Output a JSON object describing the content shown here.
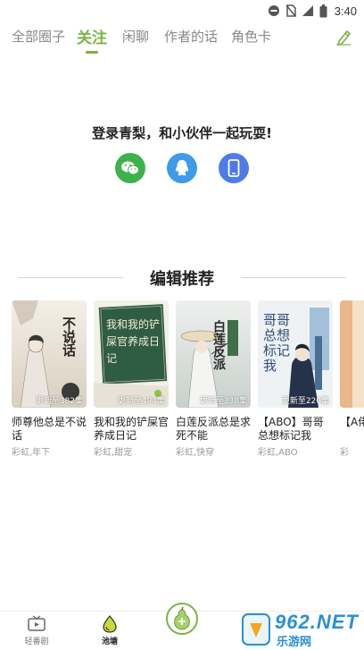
{
  "status": {
    "time": "3:40"
  },
  "tabs": [
    {
      "label": "全部圈子",
      "active": false
    },
    {
      "label": "关注",
      "active": true
    },
    {
      "label": "闲聊",
      "active": false
    },
    {
      "label": "作者的话",
      "active": false
    },
    {
      "label": "角色卡",
      "active": false
    }
  ],
  "login": {
    "title": "登录青梨，和小伙伴一起玩耍!",
    "options": [
      {
        "icon": "wechat-icon",
        "color": "#3cb34a"
      },
      {
        "icon": "qq-icon",
        "color": "#3f9ae8"
      },
      {
        "icon": "phone-icon",
        "color": "#4f7be8"
      }
    ]
  },
  "section": {
    "title": "编辑推荐"
  },
  "books": [
    {
      "title": "师尊他总是不说话",
      "tags": "彩虹,年下",
      "update": "更新至382集",
      "cover_text": "不说话"
    },
    {
      "title": "我和我的铲屎官养成日记",
      "tags": "彩虹,甜宠",
      "update": "更新至494集",
      "cover_text": "我和我的铲屎官养成日记"
    },
    {
      "title": "白莲反派总是求死不能",
      "tags": "彩虹,快穿",
      "update": "更新至338集",
      "cover_text": "白莲反派"
    },
    {
      "title": "【ABO】哥哥总想标记我",
      "tags": "彩虹,ABO",
      "update": "更新至220集",
      "cover_text": "哥哥总想标记我"
    },
    {
      "title": "【A佬",
      "tags": "彩",
      "update": "",
      "cover_text": ""
    }
  ],
  "bottom_nav": [
    {
      "label": "轻番剧",
      "icon": "tv-icon",
      "active": false
    },
    {
      "label": "池塘",
      "icon": "drop-icon",
      "active": true
    },
    {
      "label": "",
      "icon": "pear-icon",
      "active": false
    }
  ],
  "watermark": {
    "text": "962.NET",
    "sub": "乐游网"
  },
  "colors": {
    "accent": "#7cb342"
  }
}
